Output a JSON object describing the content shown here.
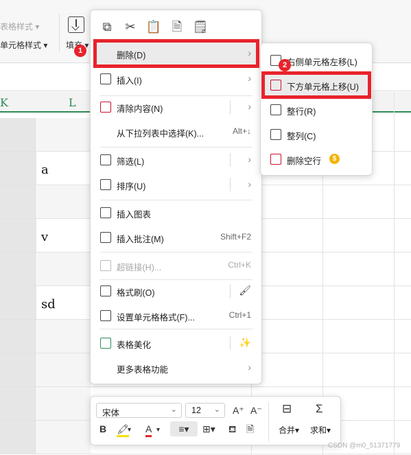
{
  "ribbon": {
    "table_style_label": "表格样式",
    "cell_style_label": "单元格样式",
    "fill_label": "填充"
  },
  "columns": [
    "K",
    "L"
  ],
  "cells": [
    "a",
    "v",
    "sd"
  ],
  "quick_icons": [
    "copy-icon",
    "cut-icon",
    "paste-icon",
    "paste-text-icon",
    "paste-special-icon"
  ],
  "menu": {
    "items": [
      {
        "label": "删除(D)",
        "arrow": "›"
      },
      {
        "label": "插入(I)",
        "arrow": "›"
      },
      {
        "label": "清除内容(N)",
        "arrow": "›"
      },
      {
        "label": "从下拉列表中选择(K)...",
        "shortcut": "Alt+↓"
      },
      {
        "label": "筛选(L)",
        "arrow": "›"
      },
      {
        "label": "排序(U)",
        "arrow": "›"
      },
      {
        "label": "插入图表"
      },
      {
        "label": "插入批注(M)",
        "shortcut": "Shift+F2"
      },
      {
        "label": "超链接(H)...",
        "shortcut": "Ctrl+K",
        "disabled": true
      },
      {
        "label": "格式刷(O)"
      },
      {
        "label": "设置单元格格式(F)...",
        "shortcut": "Ctrl+1"
      },
      {
        "label": "表格美化"
      },
      {
        "label": "更多表格功能",
        "arrow": "›"
      }
    ]
  },
  "submenu": {
    "items": [
      {
        "label": "右侧单元格左移(L)"
      },
      {
        "label": "下方单元格上移(U)"
      },
      {
        "label": "整行(R)"
      },
      {
        "label": "整列(C)"
      },
      {
        "label": "删除空行"
      }
    ]
  },
  "badges": [
    "1",
    "2"
  ],
  "mini_toolbar": {
    "font": "宋体",
    "size": "12",
    "grow": "A⁺",
    "shrink": "A⁻",
    "bold": "B",
    "merge_label": "合并",
    "sum_label": "求和"
  },
  "watermark": "CSDN @m0_51371779",
  "colors": {
    "accent_red": "#e8232b",
    "header_green": "#2e8b57",
    "coin": "#f5b301"
  }
}
